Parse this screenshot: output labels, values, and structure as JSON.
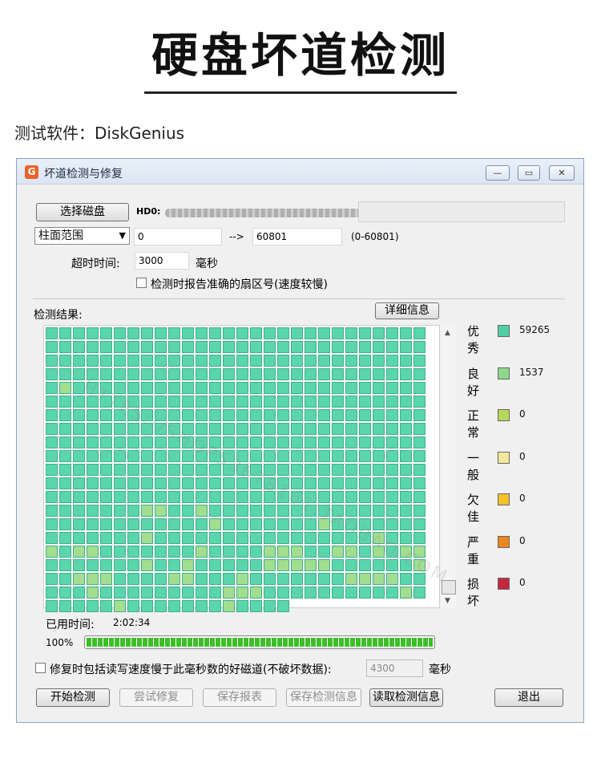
{
  "page": {
    "heading": "硬盘坏道检测",
    "subtitle": "测试软件：DiskGenius",
    "watermark": "HTTPS://SHOP53678101.TAOBAO.COM"
  },
  "window": {
    "title": "坏道检测与修复",
    "controls": {
      "minimize": "—",
      "maximize": "▭",
      "close": "✕"
    }
  },
  "disk": {
    "select_button": "选择磁盘",
    "disk_label": "HD0:"
  },
  "range": {
    "selected": "柱面范围",
    "from": "0",
    "arrow": "-->",
    "to": "60801",
    "hint": "(0-60801)"
  },
  "timeout": {
    "label": "超时时间:",
    "value": "3000",
    "unit": "毫秒"
  },
  "options": {
    "report_sector": "检测时报告准确的扇区号(速度较慢)"
  },
  "results": {
    "label": "检测结果:",
    "detail_button": "详细信息"
  },
  "legend": [
    {
      "label": "优秀",
      "count": "59265",
      "color": "#4fd0a6"
    },
    {
      "label": "良好",
      "count": "1537",
      "color": "#8ed88a"
    },
    {
      "label": "正常",
      "count": "0",
      "color": "#b7d65a"
    },
    {
      "label": "一般",
      "count": "0",
      "color": "#f5e79a"
    },
    {
      "label": "欠佳",
      "count": "0",
      "color": "#f4c12b"
    },
    {
      "label": "严重",
      "count": "0",
      "color": "#e8881e"
    },
    {
      "label": "损坏",
      "count": "0",
      "color": "#c4283d"
    }
  ],
  "elapsed": {
    "label": "已用时间:",
    "value": "2:02:34"
  },
  "progress": {
    "label": "100%",
    "value": 1.0
  },
  "repair": {
    "label": "修复时包括读写速度慢于此毫秒数的好磁道(不破坏数据):",
    "value": "4300",
    "unit": "毫秒"
  },
  "buttons": {
    "start": "开始检测",
    "try_repair": "尝试修复",
    "save_report": "保存报表",
    "save_info": "保存检测信息",
    "read_info": "读取检测信息",
    "exit": "退出"
  },
  "grid": {
    "columns": 28,
    "rows": 21,
    "last_row_filled": 18,
    "colors": {
      "excellent": "#5ad6ad",
      "good": "#a2de8f"
    },
    "good_cells": [
      [
        4,
        1
      ],
      [
        13,
        7
      ],
      [
        13,
        8
      ],
      [
        13,
        11
      ],
      [
        14,
        20
      ],
      [
        15,
        24
      ],
      [
        15,
        30
      ],
      [
        15,
        28
      ],
      [
        14,
        12
      ],
      [
        15,
        7
      ],
      [
        16,
        0
      ],
      [
        16,
        2
      ],
      [
        16,
        3
      ],
      [
        16,
        11
      ],
      [
        16,
        16
      ],
      [
        16,
        17
      ],
      [
        16,
        18
      ],
      [
        16,
        21
      ],
      [
        16,
        22
      ],
      [
        16,
        24
      ],
      [
        16,
        26
      ],
      [
        16,
        27
      ],
      [
        17,
        7
      ],
      [
        17,
        10
      ],
      [
        17,
        16
      ],
      [
        17,
        17
      ],
      [
        17,
        18
      ],
      [
        17,
        19
      ],
      [
        17,
        20
      ],
      [
        17,
        27
      ],
      [
        18,
        2
      ],
      [
        18,
        3
      ],
      [
        18,
        4
      ],
      [
        18,
        9
      ],
      [
        18,
        10
      ],
      [
        18,
        14
      ],
      [
        18,
        22
      ],
      [
        18,
        23
      ],
      [
        18,
        24
      ],
      [
        18,
        25
      ],
      [
        19,
        3
      ],
      [
        19,
        13
      ],
      [
        19,
        14
      ],
      [
        19,
        15
      ],
      [
        19,
        26
      ],
      [
        20,
        5
      ],
      [
        20,
        13
      ],
      [
        21,
        3
      ],
      [
        21,
        10
      ],
      [
        21,
        22
      ],
      [
        21,
        25
      ],
      [
        21,
        27
      ],
      [
        22,
        0
      ],
      [
        22,
        2
      ],
      [
        22,
        10
      ],
      [
        22,
        17
      ]
    ]
  }
}
